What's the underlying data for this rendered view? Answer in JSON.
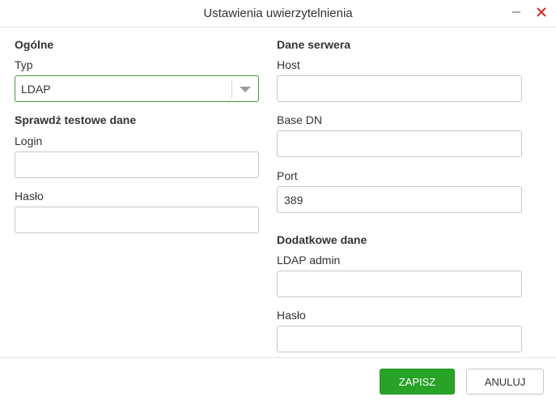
{
  "dialog": {
    "title": "Ustawienia uwierzytelnienia",
    "minimize_icon": "minimize-icon",
    "close_icon": "close-icon"
  },
  "general": {
    "section_title": "Ogólne",
    "type_label": "Typ",
    "type_value": "LDAP",
    "type_dropdown_icon": "chevron-down-icon"
  },
  "test_data": {
    "section_title": "Sprawdź testowe dane",
    "login_label": "Login",
    "login_value": "",
    "password_label": "Hasło",
    "password_value": ""
  },
  "server": {
    "section_title": "Dane serwera",
    "host_label": "Host",
    "host_value": "",
    "base_dn_label": "Base DN",
    "base_dn_value": "",
    "port_label": "Port",
    "port_value": "389"
  },
  "additional": {
    "section_title": "Dodatkowe dane",
    "ldap_admin_label": "LDAP admin",
    "ldap_admin_value": "",
    "password_label": "Hasło",
    "password_value": ""
  },
  "footer": {
    "save_label": "ZAPISZ",
    "cancel_label": "ANULUJ"
  },
  "colors": {
    "primary": "#28a328",
    "select_border": "#4a9a3a",
    "close_icon": "#d32f2f"
  }
}
